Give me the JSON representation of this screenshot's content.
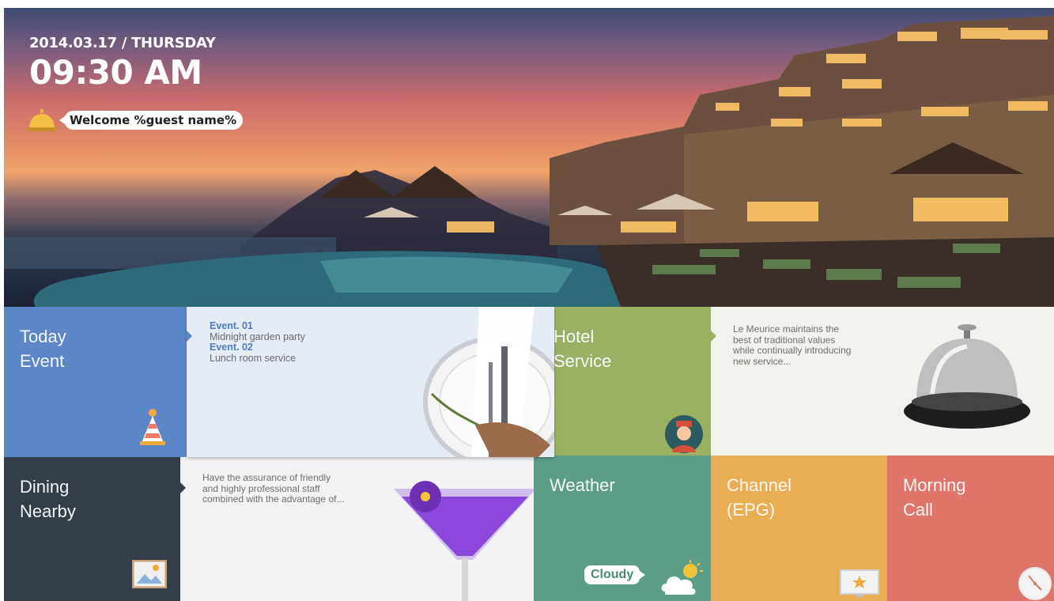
{
  "header": {
    "date": "2014.03.17 / THURSDAY",
    "time": "09:30 AM",
    "welcome": "Welcome %guest name%"
  },
  "tiles": {
    "today_event": {
      "title": "Today\nEvent",
      "icon": "party-hat-icon",
      "color": "#5b87c8"
    },
    "events": [
      {
        "label": "Event. 01",
        "desc": "Midnight garden party"
      },
      {
        "label": "Event. 02",
        "desc": "Lunch room service"
      }
    ],
    "hotel_service": {
      "title": "Hotel\nService",
      "icon": "bellboy-icon",
      "color": "#9ab163"
    },
    "hotel_text": "Le Meurice maintains the best of traditional values while continually introducing new service...",
    "dining_nearby": {
      "title": "Dining\nNearby",
      "icon": "picture-frame-icon",
      "color": "#333e49"
    },
    "dining_text": "Have the assurance of friendly and highly professional staff combined with the advantage of...",
    "weather": {
      "title": "Weather",
      "condition": "Cloudy",
      "icon": "cloud-sun-icon",
      "color": "#5a9e87"
    },
    "channel": {
      "title": "Channel\n(EPG)",
      "icon": "tv-star-icon",
      "color": "#e9ae54"
    },
    "morning_call": {
      "title": "Morning\nCall",
      "icon": "clock-icon",
      "color": "#e0756a"
    }
  }
}
